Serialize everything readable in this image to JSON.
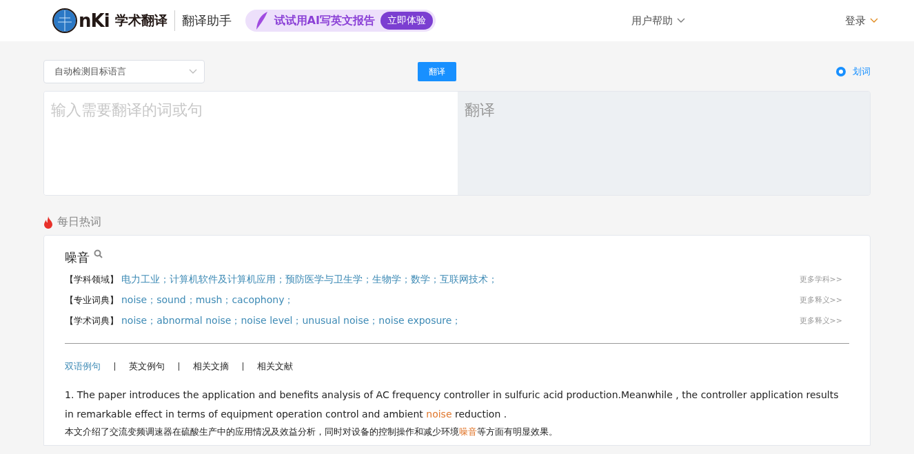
{
  "header": {
    "logo_text": "nKi",
    "brand": "学术翻译",
    "product": "翻译助手",
    "promo": {
      "text": "试试用AI写英文报告",
      "button": "立即体验"
    },
    "help": "用户帮助",
    "login": "登录"
  },
  "toolbar": {
    "language_select": "自动检测目标语言",
    "translate_button": "翻译",
    "word_pick": {
      "label": "划词",
      "selected": true
    }
  },
  "editor": {
    "input_placeholder": "输入需要翻译的词或句",
    "output_placeholder": "翻译"
  },
  "hot_words": {
    "title": "每日热词",
    "word": "噪音",
    "rows": [
      {
        "label": "【学科领域】",
        "items": "电力工业；计算机软件及计算机应用；预防医学与卫生学；生物学；数学；互联网技术；",
        "more": "更多学科>>"
      },
      {
        "label": "【专业词典】",
        "items": "noise；sound；mush；cacophony；",
        "more": "更多释义>>"
      },
      {
        "label": "【学术词典】",
        "items": "noise；abnormal noise；noise level；unusual noise；noise exposure；",
        "more": "更多释义>>"
      }
    ],
    "tabs": [
      {
        "label": "双语例句",
        "selected": true
      },
      {
        "label": "英文例句",
        "selected": false
      },
      {
        "label": "相关文摘",
        "selected": false
      },
      {
        "label": "相关文献",
        "selected": false
      }
    ],
    "examples": [
      {
        "english": [
          {
            "text": "1. The paper introduces the application and benefits analysis of AC frequency controller in sulfuric acid production.Meanwhile , the controller application results in remarkable effect in terms of equipment operation control and ambient ",
            "highlight": false
          },
          {
            "text": "noise",
            "highlight": true
          },
          {
            "text": " reduction .",
            "highlight": false
          }
        ],
        "chinese": [
          {
            "text": "本文介绍了交流变频调速器在硫酸生产中的应用情况及效益分析，同时对设备的控制操作和减少环境",
            "highlight": false
          },
          {
            "text": "噪音",
            "highlight": true
          },
          {
            "text": "等方面有明显效果。",
            "highlight": false
          }
        ]
      }
    ]
  }
}
